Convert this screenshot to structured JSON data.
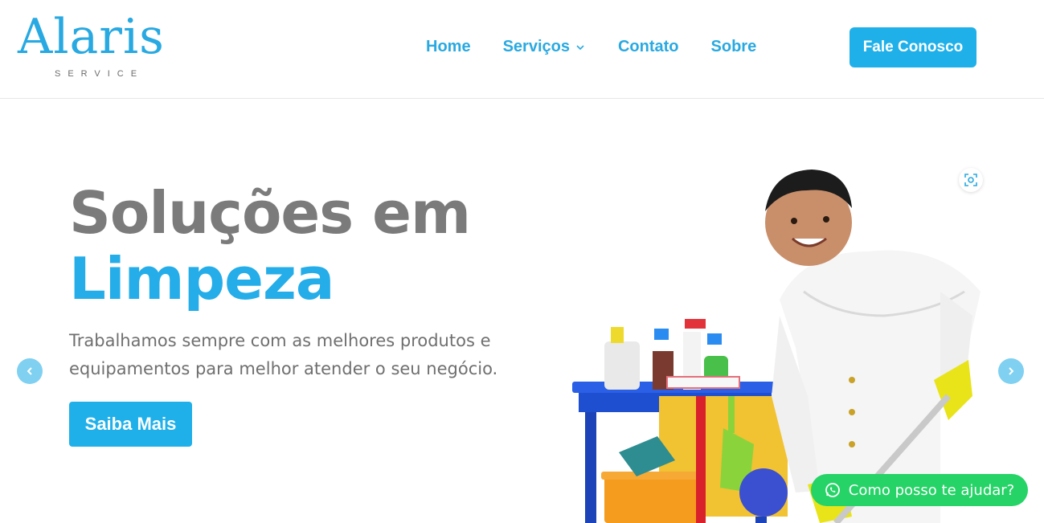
{
  "brand": {
    "name": "Alaris",
    "tagline": "SERVICE",
    "color": "#29a9e1"
  },
  "nav": {
    "items": [
      {
        "label": "Home"
      },
      {
        "label": "Serviços",
        "has_dropdown": true
      },
      {
        "label": "Contato"
      },
      {
        "label": "Sobre"
      }
    ],
    "cta": "Fale Conosco"
  },
  "hero": {
    "title_line1": "Soluções em",
    "title_line2": "Limpeza",
    "description": "Trabalhamos sempre com as melhores produtos e equipamentos para melhor atender o seu negócio.",
    "button": "Saiba Mais"
  },
  "slider": {
    "prev_icon": "chevron-left-icon",
    "next_icon": "chevron-right-icon"
  },
  "chat": {
    "label": "Como posso te ajudar?",
    "icon": "whatsapp-icon",
    "color": "#25d366"
  },
  "colors": {
    "accent": "#1fb0ea",
    "title_gray": "#7b7b7b"
  }
}
